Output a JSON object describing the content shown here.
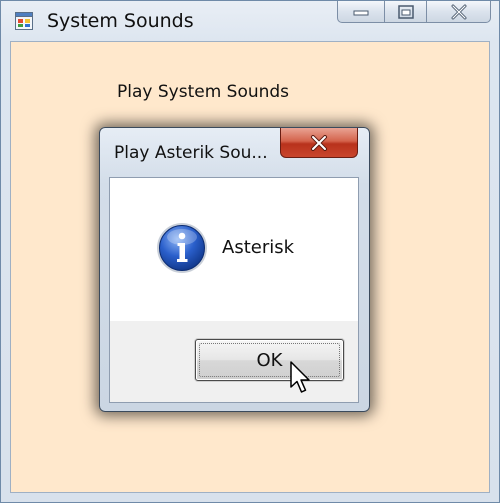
{
  "window": {
    "title": "System Sounds",
    "icon": "app-window-icon",
    "caption_buttons": [
      "minimize-icon",
      "maximize-icon",
      "close-icon"
    ],
    "client_background": "#ffe8cc"
  },
  "main": {
    "label": "Play System Sounds"
  },
  "dialog": {
    "title": "Play Asterik Sou...",
    "icon": "information-icon",
    "message": "Asterisk",
    "ok_label": "OK",
    "close_icon": "close-icon",
    "close_color": "#c9452c"
  },
  "cursor": "arrow-pointer-icon"
}
